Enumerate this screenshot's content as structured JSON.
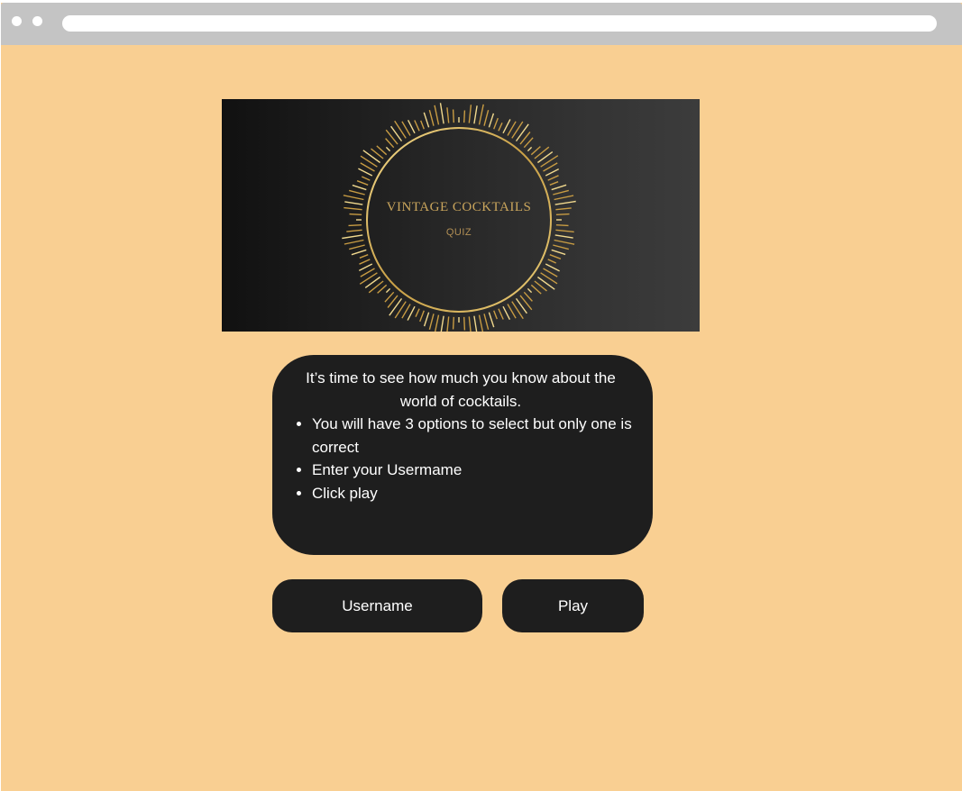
{
  "browser": {
    "address_bar_value": ""
  },
  "banner": {
    "logo_title": "VINTAGE COCKTAILS",
    "logo_subtitle": "QUIZ",
    "colors": {
      "gold": "#d9b45a",
      "background_dark": "#111111",
      "background_light": "#3c3c3c"
    }
  },
  "info": {
    "intro": "It’s time to see how much you know about the world of cocktails.",
    "rules": [
      "You will have 3 options to select but only one is correct",
      "Enter your Usermame",
      "Click play"
    ]
  },
  "buttons": {
    "username_label": "Username",
    "play_label": "Play"
  },
  "colors": {
    "page_background": "#f9cf92",
    "panel": "#1e1e1e",
    "text_light": "#ffffff",
    "chrome": "#c4c4c4"
  }
}
